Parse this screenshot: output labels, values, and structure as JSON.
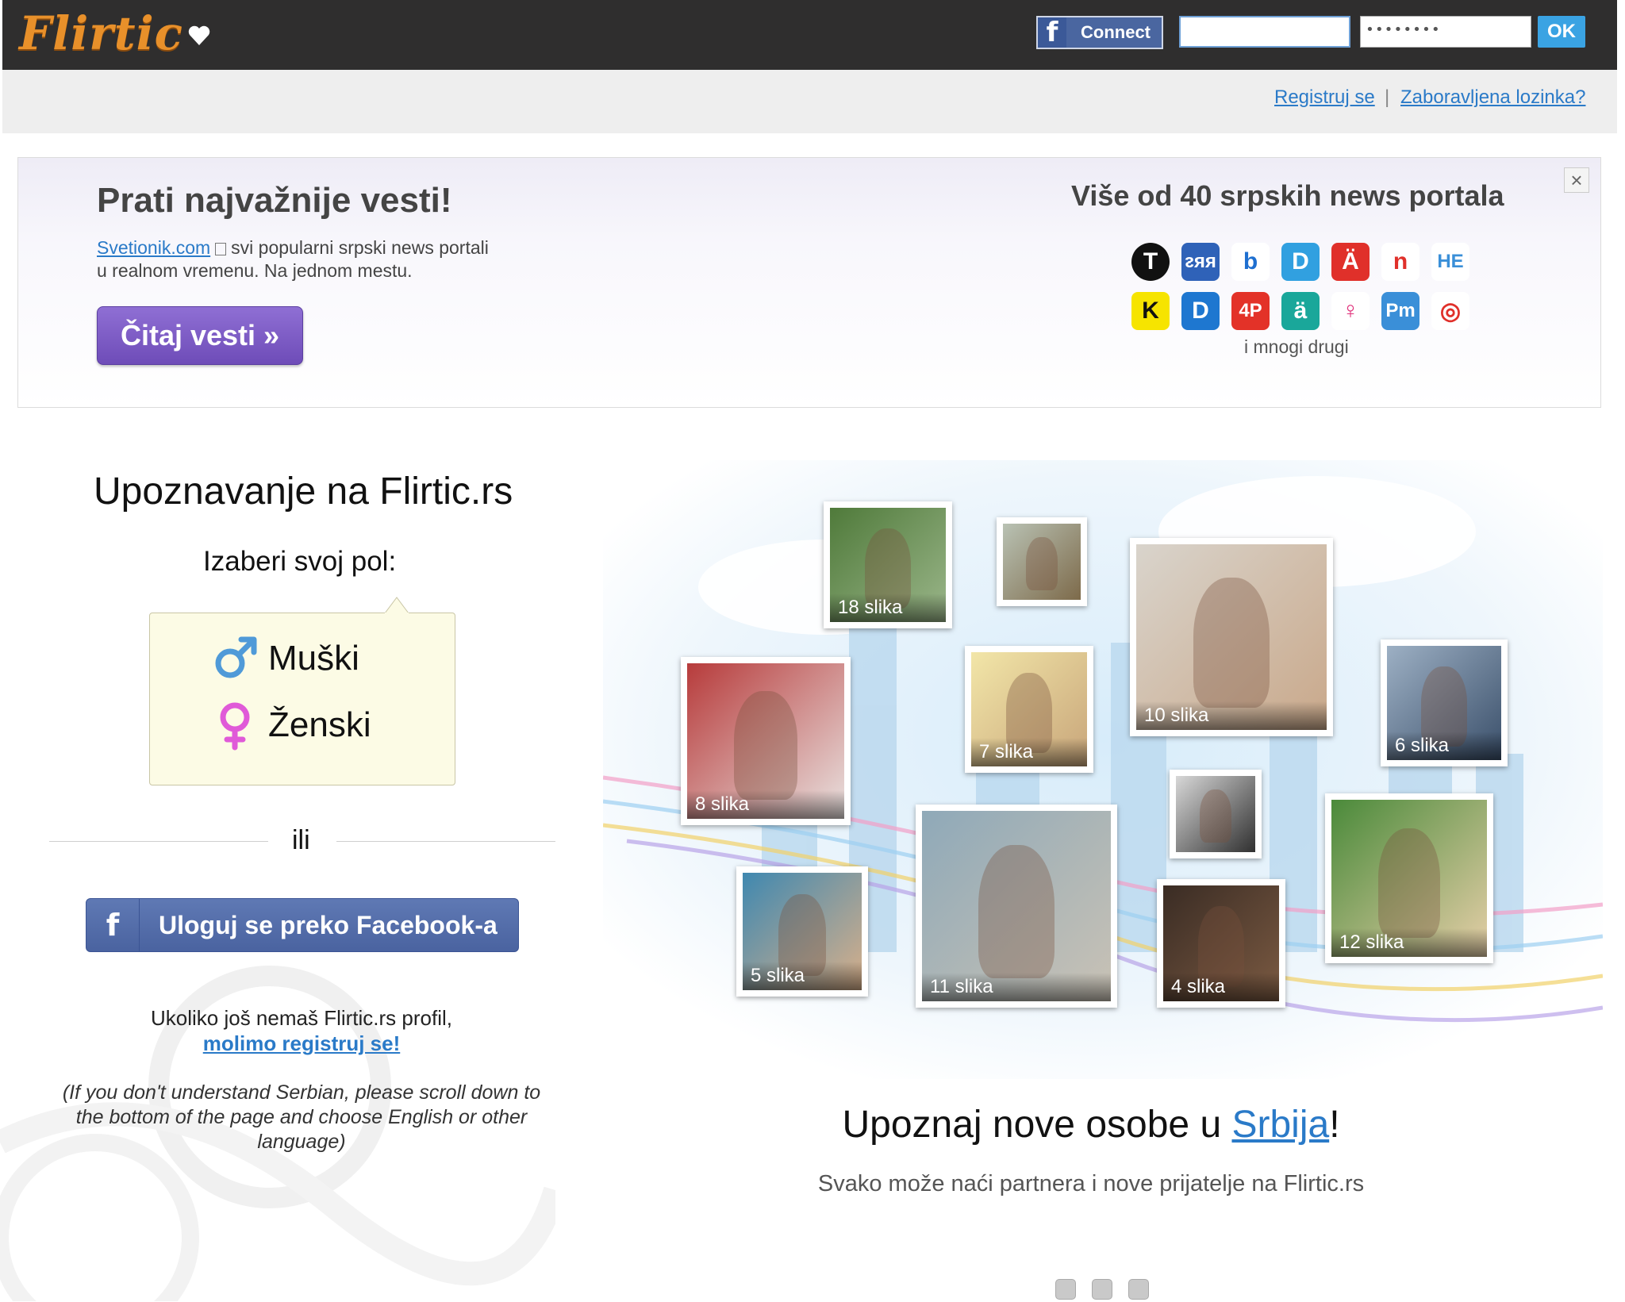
{
  "header": {
    "logo_text": "Flirtic",
    "fb_connect_label": "Connect",
    "password_value": "••••••••",
    "ok_label": "OK"
  },
  "subnav": {
    "register": "Registruj se",
    "separator": "|",
    "forgot_password": "Zaboravljena lozinka?"
  },
  "banner": {
    "title": "Prati najvažnije vesti!",
    "site_link": "Svetionik.com",
    "desc_line1": "svi popularni srpski news portali",
    "desc_line2": "u realnom vremenu. Na jednom mestu.",
    "button": "Čitaj vesti »",
    "right_title": "Više od 40 srpskih news portala",
    "more": "i mnogi drugi",
    "close": "×",
    "portals": [
      {
        "label": "T",
        "bg": "#111111"
      },
      {
        "label": "ᴤᴙᴙ",
        "bg": "#2f62b8"
      },
      {
        "label": "b",
        "bg": "#ffffff"
      },
      {
        "label": "D",
        "bg": "#31a0e0"
      },
      {
        "label": "Ä",
        "bg": "#e0302a"
      },
      {
        "label": "n",
        "bg": "#ffffff"
      },
      {
        "label": "HE",
        "bg": "#ffffff"
      },
      {
        "label": "K",
        "bg": "#f6e400"
      },
      {
        "label": "D",
        "bg": "#1e77d0"
      },
      {
        "label": "4P",
        "bg": "#e33228"
      },
      {
        "label": "ä",
        "bg": "#1aa79a"
      },
      {
        "label": "♀",
        "bg": "#ffffff"
      },
      {
        "label": "Pm",
        "bg": "#3a8fd8"
      },
      {
        "label": "◎",
        "bg": "#ffffff"
      }
    ]
  },
  "left": {
    "title": "Upoznavanje na Flirtic.rs",
    "gender_prompt": "Izaberi svoj pol:",
    "male": "Muški",
    "female": "Ženski",
    "or": "ili",
    "fb_login": "Uloguj se preko Facebook-a",
    "no_profile": "Ukoliko još nemaš Flirtic.rs profil,",
    "register_link": "molimo registruj se!",
    "english_note": "(If you don't understand Serbian, please scroll down to the bottom of the page and choose English or other language)"
  },
  "photos": [
    {
      "caption": "18 slika"
    },
    {
      "caption": ""
    },
    {
      "caption": "10 slika"
    },
    {
      "caption": "7 slika"
    },
    {
      "caption": "8 slika"
    },
    {
      "caption": "6 slika"
    },
    {
      "caption": ""
    },
    {
      "caption": "11 slika"
    },
    {
      "caption": "5 slika"
    },
    {
      "caption": "4 slika"
    },
    {
      "caption": "12 slika"
    }
  ],
  "meet": {
    "title_pre": "Upoznaj nove osobe u ",
    "title_link": "Srbija",
    "title_post": "!",
    "subtitle": "Svako može naći partnera i nove prijatelje na Flirtic.rs"
  },
  "colors": {
    "topbar": "#2f2e2e",
    "logo": "#e8902a",
    "link": "#2a7ac8",
    "facebook": "#4a63a0",
    "cta_purple": "#6e4cb8",
    "gender_box": "#fcfbe5"
  }
}
